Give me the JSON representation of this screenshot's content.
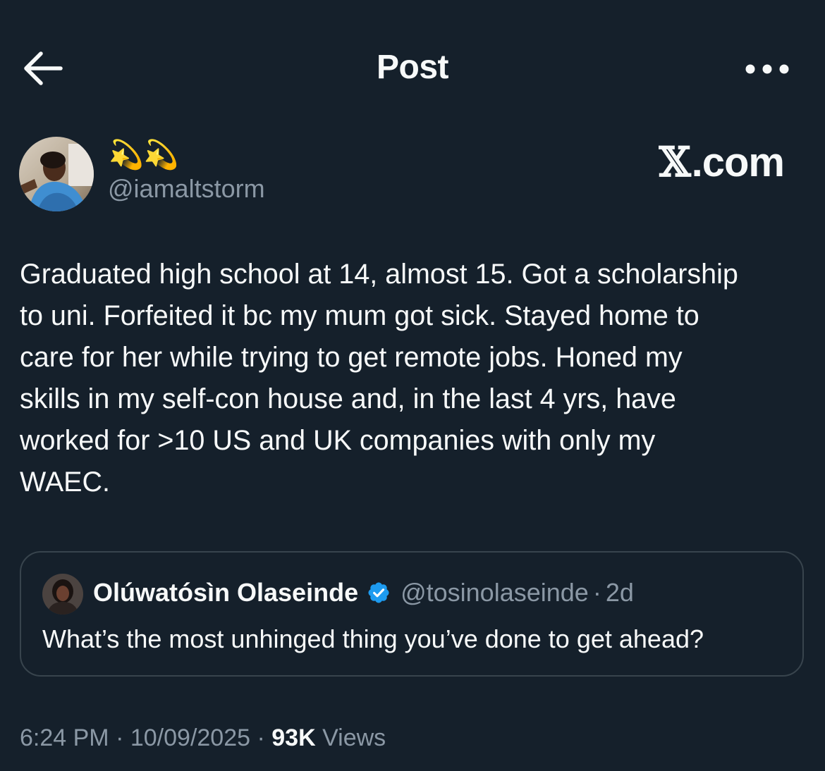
{
  "header": {
    "title": "Post",
    "back_icon": "arrow-left-icon",
    "more_icon": "more-dots-icon"
  },
  "author": {
    "display_name": "💫💫",
    "handle": "@iamaltstorm"
  },
  "watermark": {
    "x_glyph": "𝕏",
    "text": ".com"
  },
  "post": {
    "text": "Graduated high school at 14, almost 15. Got a scholarship\nto uni. Forfeited it bc my mum got sick. Stayed home to\ncare for her while trying to get remote jobs. Honed my\nskills in my self-con house and, in the last 4 yrs, have\nworked for >10 US and UK companies with only my\nWAEC."
  },
  "quote": {
    "name": "Olúwatósìn Olaseinde",
    "handle": "@tosinolaseinde",
    "separator": "·",
    "time": "2d",
    "text": "What’s the most unhinged thing you’ve done to get ahead?",
    "verified_icon": "verified-badge-icon"
  },
  "meta": {
    "time": "6:24 PM",
    "sep1": "·",
    "date": "10/09/2025",
    "sep2": "·",
    "views_count": "93K",
    "views_label": "Views"
  },
  "colors": {
    "background": "#15202b",
    "text": "#f7f9f9",
    "muted": "#8b98a5",
    "border": "#38444d",
    "verified": "#1d9bf0"
  }
}
